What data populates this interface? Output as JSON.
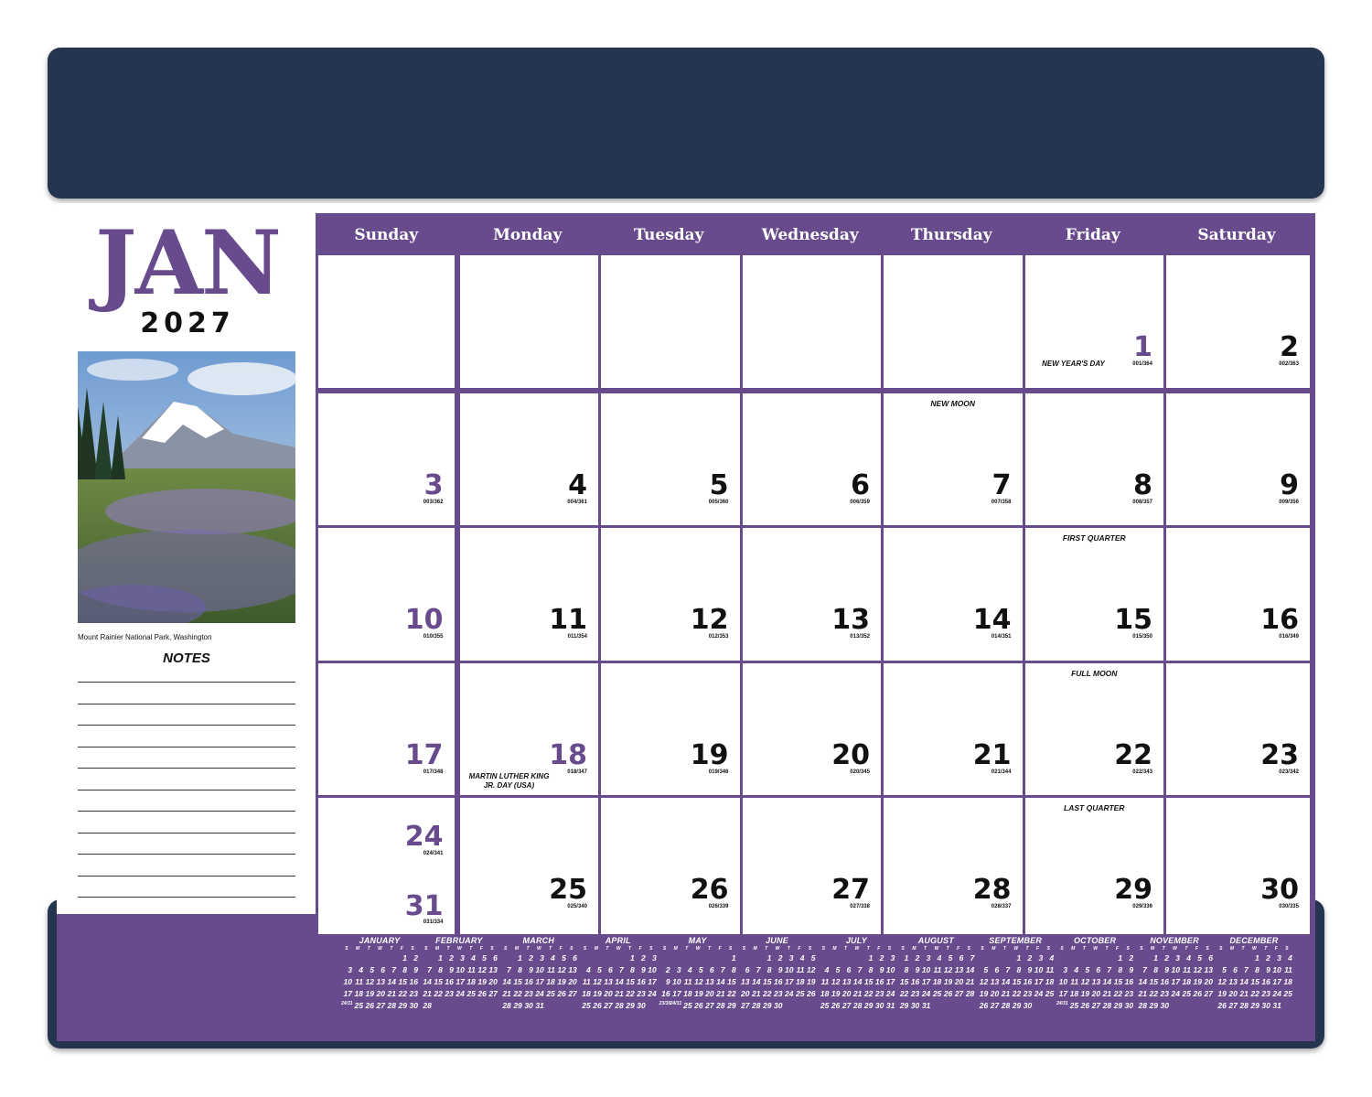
{
  "header": {
    "month": "JAN",
    "year": "2027"
  },
  "photo": {
    "caption": "Mount Rainier National Park, Washington"
  },
  "notes": {
    "title": "NOTES"
  },
  "weekdays": [
    "Sunday",
    "Monday",
    "Tuesday",
    "Wednesday",
    "Thursday",
    "Friday",
    "Saturday"
  ],
  "weeks": [
    [
      null,
      null,
      null,
      null,
      null,
      {
        "day": "1",
        "doy": "001/364",
        "color": "purple",
        "note": "NEW YEAR'S DAY"
      },
      {
        "day": "2",
        "doy": "002/363"
      }
    ],
    [
      {
        "day": "3",
        "doy": "003/362",
        "color": "purple"
      },
      {
        "day": "4",
        "doy": "004/361"
      },
      {
        "day": "5",
        "doy": "005/360"
      },
      {
        "day": "6",
        "doy": "006/359"
      },
      {
        "day": "7",
        "doy": "007/358",
        "top": "NEW MOON"
      },
      {
        "day": "8",
        "doy": "008/357"
      },
      {
        "day": "9",
        "doy": "009/356"
      }
    ],
    [
      {
        "day": "10",
        "doy": "010/355",
        "color": "purple"
      },
      {
        "day": "11",
        "doy": "011/354"
      },
      {
        "day": "12",
        "doy": "012/353"
      },
      {
        "day": "13",
        "doy": "013/352"
      },
      {
        "day": "14",
        "doy": "014/351"
      },
      {
        "day": "15",
        "doy": "015/350",
        "top": "FIRST QUARTER"
      },
      {
        "day": "16",
        "doy": "016/349"
      }
    ],
    [
      {
        "day": "17",
        "doy": "017/348",
        "color": "purple"
      },
      {
        "day": "18",
        "doy": "018/347",
        "color": "purple",
        "note": "MARTIN LUTHER KING JR. DAY (USA)"
      },
      {
        "day": "19",
        "doy": "019/346"
      },
      {
        "day": "20",
        "doy": "020/345"
      },
      {
        "day": "21",
        "doy": "021/344"
      },
      {
        "day": "22",
        "doy": "022/343",
        "top": "FULL MOON"
      },
      {
        "day": "23",
        "doy": "023/342"
      }
    ],
    [
      {
        "day": "24",
        "doy": "024/341",
        "color": "purple",
        "day2": "31",
        "doy2": "031/334"
      },
      {
        "day": "25",
        "doy": "025/340"
      },
      {
        "day": "26",
        "doy": "026/339"
      },
      {
        "day": "27",
        "doy": "027/338"
      },
      {
        "day": "28",
        "doy": "028/337"
      },
      {
        "day": "29",
        "doy": "029/336",
        "top": "LAST QUARTER"
      },
      {
        "day": "30",
        "doy": "030/335"
      }
    ]
  ],
  "mini_calendars": {
    "dow": [
      "S",
      "M",
      "T",
      "W",
      "T",
      "F",
      "S"
    ],
    "months": [
      {
        "name": "JANUARY",
        "rows": [
          [
            "",
            "",
            "",
            "",
            "",
            "1",
            "2"
          ],
          [
            "3",
            "4",
            "5",
            "6",
            "7",
            "8",
            "9"
          ],
          [
            "10",
            "11",
            "12",
            "13",
            "14",
            "15",
            "16"
          ],
          [
            "17",
            "18",
            "19",
            "20",
            "21",
            "22",
            "23"
          ],
          [
            "24/31",
            "25",
            "26",
            "27",
            "28",
            "29",
            "30"
          ]
        ]
      },
      {
        "name": "FEBRUARY",
        "rows": [
          [
            "",
            "1",
            "2",
            "3",
            "4",
            "5",
            "6"
          ],
          [
            "7",
            "8",
            "9",
            "10",
            "11",
            "12",
            "13"
          ],
          [
            "14",
            "15",
            "16",
            "17",
            "18",
            "19",
            "20"
          ],
          [
            "21",
            "22",
            "23",
            "24",
            "25",
            "26",
            "27"
          ],
          [
            "28",
            "",
            "",
            "",
            "",
            "",
            ""
          ]
        ]
      },
      {
        "name": "MARCH",
        "rows": [
          [
            "",
            "1",
            "2",
            "3",
            "4",
            "5",
            "6"
          ],
          [
            "7",
            "8",
            "9",
            "10",
            "11",
            "12",
            "13"
          ],
          [
            "14",
            "15",
            "16",
            "17",
            "18",
            "19",
            "20"
          ],
          [
            "21",
            "22",
            "23",
            "24",
            "25",
            "26",
            "27"
          ],
          [
            "28",
            "29",
            "30",
            "31",
            "",
            "",
            ""
          ]
        ]
      },
      {
        "name": "APRIL",
        "rows": [
          [
            "",
            "",
            "",
            "",
            "1",
            "2",
            "3"
          ],
          [
            "4",
            "5",
            "6",
            "7",
            "8",
            "9",
            "10"
          ],
          [
            "11",
            "12",
            "13",
            "14",
            "15",
            "16",
            "17"
          ],
          [
            "18",
            "19",
            "20",
            "21",
            "22",
            "23",
            "24"
          ],
          [
            "25",
            "26",
            "27",
            "28",
            "29",
            "30",
            ""
          ]
        ]
      },
      {
        "name": "MAY",
        "rows": [
          [
            "",
            "",
            "",
            "",
            "",
            "",
            "1"
          ],
          [
            "2",
            "3",
            "4",
            "5",
            "6",
            "7",
            "8"
          ],
          [
            "9",
            "10",
            "11",
            "12",
            "13",
            "14",
            "15"
          ],
          [
            "16",
            "17",
            "18",
            "19",
            "20",
            "21",
            "22"
          ],
          [
            "23/30",
            "24/31",
            "25",
            "26",
            "27",
            "28",
            "29"
          ]
        ]
      },
      {
        "name": "JUNE",
        "rows": [
          [
            "",
            "",
            "1",
            "2",
            "3",
            "4",
            "5"
          ],
          [
            "6",
            "7",
            "8",
            "9",
            "10",
            "11",
            "12"
          ],
          [
            "13",
            "14",
            "15",
            "16",
            "17",
            "18",
            "19"
          ],
          [
            "20",
            "21",
            "22",
            "23",
            "24",
            "25",
            "26"
          ],
          [
            "27",
            "28",
            "29",
            "30",
            "",
            "",
            ""
          ]
        ]
      },
      {
        "name": "JULY",
        "rows": [
          [
            "",
            "",
            "",
            "",
            "1",
            "2",
            "3"
          ],
          [
            "4",
            "5",
            "6",
            "7",
            "8",
            "9",
            "10"
          ],
          [
            "11",
            "12",
            "13",
            "14",
            "15",
            "16",
            "17"
          ],
          [
            "18",
            "19",
            "20",
            "21",
            "22",
            "23",
            "24"
          ],
          [
            "25",
            "26",
            "27",
            "28",
            "29",
            "30",
            "31"
          ]
        ]
      },
      {
        "name": "AUGUST",
        "rows": [
          [
            "1",
            "2",
            "3",
            "4",
            "5",
            "6",
            "7"
          ],
          [
            "8",
            "9",
            "10",
            "11",
            "12",
            "13",
            "14"
          ],
          [
            "15",
            "16",
            "17",
            "18",
            "19",
            "20",
            "21"
          ],
          [
            "22",
            "23",
            "24",
            "25",
            "26",
            "27",
            "28"
          ],
          [
            "29",
            "30",
            "31",
            "",
            "",
            "",
            ""
          ]
        ]
      },
      {
        "name": "SEPTEMBER",
        "rows": [
          [
            "",
            "",
            "",
            "1",
            "2",
            "3",
            "4"
          ],
          [
            "5",
            "6",
            "7",
            "8",
            "9",
            "10",
            "11"
          ],
          [
            "12",
            "13",
            "14",
            "15",
            "16",
            "17",
            "18"
          ],
          [
            "19",
            "20",
            "21",
            "22",
            "23",
            "24",
            "25"
          ],
          [
            "26",
            "27",
            "28",
            "29",
            "30",
            "",
            ""
          ]
        ]
      },
      {
        "name": "OCTOBER",
        "rows": [
          [
            "",
            "",
            "",
            "",
            "",
            "1",
            "2"
          ],
          [
            "3",
            "4",
            "5",
            "6",
            "7",
            "8",
            "9"
          ],
          [
            "10",
            "11",
            "12",
            "13",
            "14",
            "15",
            "16"
          ],
          [
            "17",
            "18",
            "19",
            "20",
            "21",
            "22",
            "23"
          ],
          [
            "24/31",
            "25",
            "26",
            "27",
            "28",
            "29",
            "30"
          ]
        ]
      },
      {
        "name": "NOVEMBER",
        "rows": [
          [
            "",
            "1",
            "2",
            "3",
            "4",
            "5",
            "6"
          ],
          [
            "7",
            "8",
            "9",
            "10",
            "11",
            "12",
            "13"
          ],
          [
            "14",
            "15",
            "16",
            "17",
            "18",
            "19",
            "20"
          ],
          [
            "21",
            "22",
            "23",
            "24",
            "25",
            "26",
            "27"
          ],
          [
            "28",
            "29",
            "30",
            "",
            "",
            "",
            ""
          ]
        ]
      },
      {
        "name": "DECEMBER",
        "rows": [
          [
            "",
            "",
            "",
            "1",
            "2",
            "3",
            "4"
          ],
          [
            "5",
            "6",
            "7",
            "8",
            "9",
            "10",
            "11"
          ],
          [
            "12",
            "13",
            "14",
            "15",
            "16",
            "17",
            "18"
          ],
          [
            "19",
            "20",
            "21",
            "22",
            "23",
            "24",
            "25"
          ],
          [
            "26",
            "27",
            "28",
            "29",
            "30",
            "31",
            ""
          ]
        ]
      }
    ]
  },
  "colors": {
    "navy": "#25354f",
    "purple": "#674b8d"
  }
}
